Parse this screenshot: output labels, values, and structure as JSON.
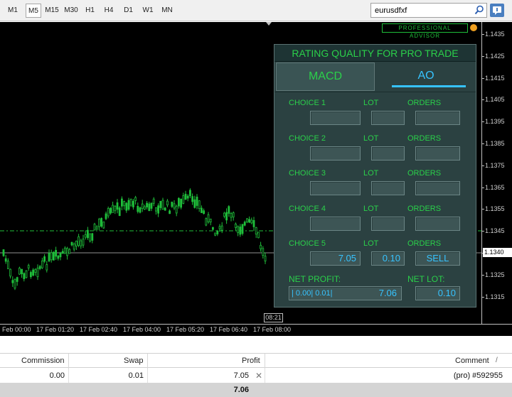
{
  "toolbar": {
    "timeframes": [
      "M1",
      "M5",
      "M15",
      "M30",
      "H1",
      "H4",
      "D1",
      "W1",
      "MN"
    ],
    "active_timeframe": "M5",
    "search_value": "eurusdfxf"
  },
  "chart": {
    "badge": "PROFESSIONAL ADVISOR",
    "price_labels": [
      "1.1435",
      "1.1425",
      "1.1415",
      "1.1405",
      "1.1395",
      "1.1385",
      "1.1375",
      "1.1365",
      "1.1355",
      "1.1345",
      "1.1335",
      "1.1325",
      "1.1315"
    ],
    "current_price": "1.1340",
    "time_labels": [
      "Feb 00:00",
      "17 Feb 01:20",
      "17 Feb 02:40",
      "17 Feb 04:00",
      "17 Feb 05:20",
      "17 Feb 06:40",
      "17 Feb 08:00"
    ],
    "time_badge": "08:21",
    "colors": {
      "background": "#000000",
      "candles": "#1fbf3a",
      "level_line": "#1fbf3a",
      "price_line": "#c0c0c0"
    }
  },
  "panel": {
    "title": "RATING QUALITY FOR PRO TRADE",
    "tabs": [
      {
        "label": "MACD",
        "active": false
      },
      {
        "label": "AO",
        "active": true
      }
    ],
    "choices": [
      {
        "label": "CHOICE 1",
        "lot_label": "LOT",
        "orders_label": "ORDERS",
        "value": "",
        "lot": "",
        "orders": ""
      },
      {
        "label": "CHOICE 2",
        "lot_label": "LOT",
        "orders_label": "ORDERS",
        "value": "",
        "lot": "",
        "orders": ""
      },
      {
        "label": "CHOICE 3",
        "lot_label": "LOT",
        "orders_label": "ORDERS",
        "value": "",
        "lot": "",
        "orders": ""
      },
      {
        "label": "CHOICE 4",
        "lot_label": "LOT",
        "orders_label": "ORDERS",
        "value": "",
        "lot": "",
        "orders": ""
      },
      {
        "label": "CHOICE 5",
        "lot_label": "LOT",
        "orders_label": "ORDERS",
        "value": "7.05",
        "lot": "0.10",
        "orders": "SELL"
      }
    ],
    "net_profit_label": "NET PROFIT:",
    "net_lot_label": "NET LOT:",
    "net_profit_prefix": "| 0.00| 0.01|",
    "net_profit_value": "7.06",
    "net_lot_value": "0.10",
    "colors": {
      "bg": "#2b4141",
      "label": "#2bd04a",
      "value": "#36c3ff"
    }
  },
  "terminal": {
    "columns": [
      "Commission",
      "Swap",
      "Profit",
      "Comment"
    ],
    "row": {
      "commission": "0.00",
      "swap": "0.01",
      "profit": "7.05",
      "comment": "(pro) #592955"
    },
    "total": "7.06",
    "sort_indicator": "/"
  }
}
